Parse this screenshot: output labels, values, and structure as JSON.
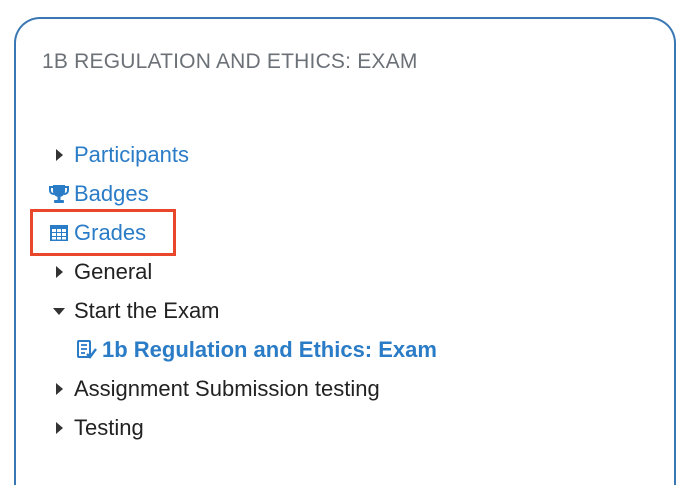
{
  "block": {
    "title": "1B REGULATION AND ETHICS: EXAM"
  },
  "nav": {
    "participants": {
      "label": "Participants",
      "icon": "caret-right-icon"
    },
    "badges": {
      "label": "Badges",
      "icon": "trophy-icon"
    },
    "grades": {
      "label": "Grades",
      "icon": "table-icon",
      "highlighted": true
    },
    "general": {
      "label": "General",
      "icon": "caret-right-icon"
    },
    "start_exam": {
      "label": "Start the Exam",
      "icon": "caret-down-icon"
    },
    "exam_quiz": {
      "label": "1b Regulation and Ethics: Exam",
      "icon": "quiz-icon"
    },
    "assignment": {
      "label": "Assignment Submission testing",
      "icon": "caret-right-icon"
    },
    "testing": {
      "label": "Testing",
      "icon": "caret-right-icon"
    }
  },
  "colors": {
    "link": "#2a7cc7",
    "border": "#3a78b5",
    "highlight": "#e8472c"
  }
}
